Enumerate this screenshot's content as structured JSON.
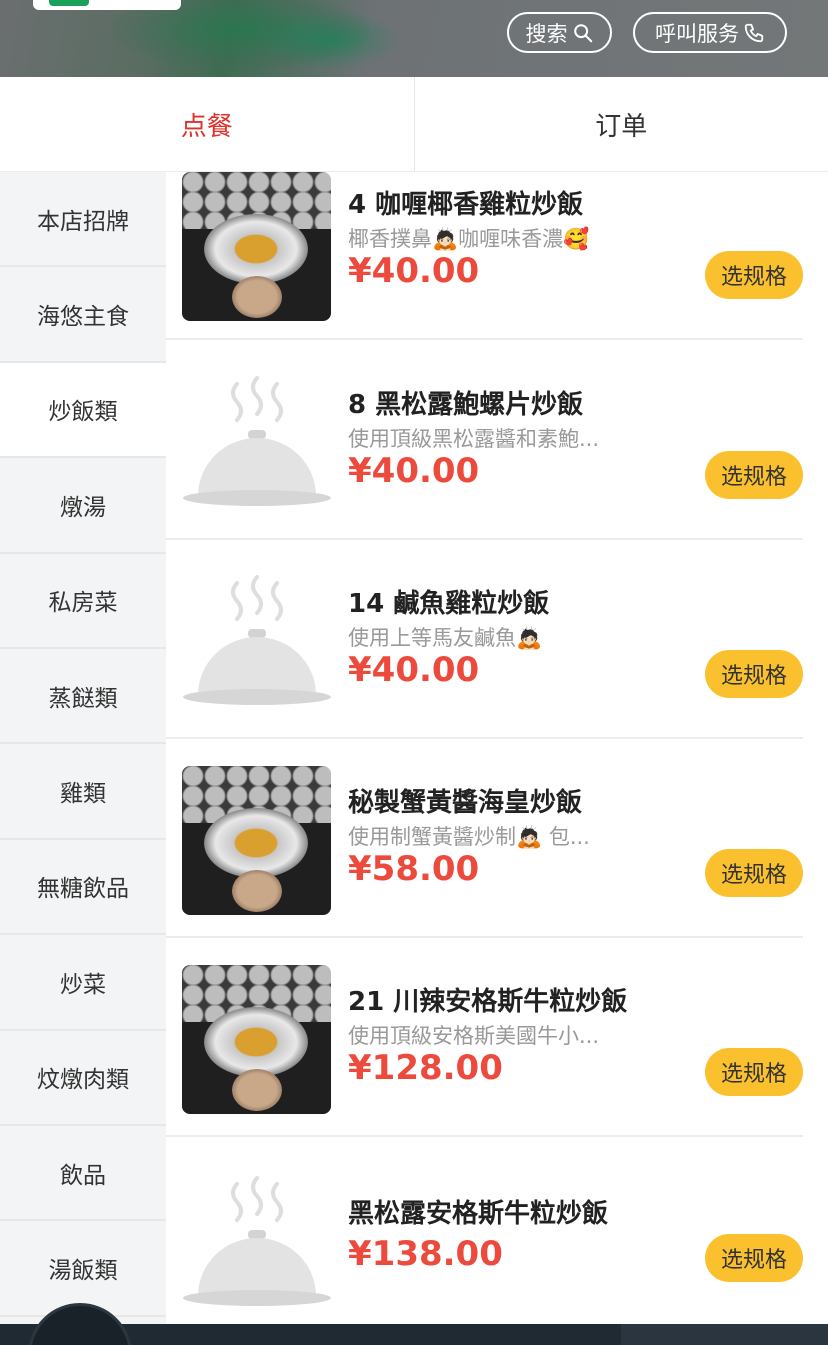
{
  "header": {
    "search_label": "搜索",
    "call_label": "呼叫服务"
  },
  "tabs": [
    {
      "label": "点餐",
      "active": true
    },
    {
      "label": "订单",
      "active": false
    }
  ],
  "sidebar": {
    "items": [
      {
        "label": "本店招牌"
      },
      {
        "label": "海悠主食"
      },
      {
        "label": "炒飯類",
        "active": true
      },
      {
        "label": "燉湯"
      },
      {
        "label": "私房菜"
      },
      {
        "label": "蒸餸類"
      },
      {
        "label": "雞類"
      },
      {
        "label": "無糖飲品"
      },
      {
        "label": "炒菜"
      },
      {
        "label": "炆燉肉類"
      },
      {
        "label": "飲品"
      },
      {
        "label": "湯飯類"
      }
    ]
  },
  "products": [
    {
      "name": "4 咖喱椰香雞粒炒飯",
      "desc": "椰香撲鼻🙇🏻咖喱味香濃🥰",
      "price": "¥40.00",
      "button": "选规格",
      "image": "photo"
    },
    {
      "name": "8 黑松露鮑螺片炒飯",
      "desc": "使用頂級黑松露醬和素鮑...",
      "price": "¥40.00",
      "button": "选规格",
      "image": "placeholder"
    },
    {
      "name": "14 鹹魚雞粒炒飯",
      "desc": "使用上等馬友鹹魚🙇🏻",
      "price": "¥40.00",
      "button": "选规格",
      "image": "placeholder"
    },
    {
      "name": "秘製蟹黃醬海皇炒飯",
      "desc": "使用制蟹黃醬炒制🙇🏻 包...",
      "price": "¥58.00",
      "button": "选规格",
      "image": "photo"
    },
    {
      "name": "21 川辣安格斯牛粒炒飯",
      "desc": "使用頂級安格斯美國牛小...",
      "price": "¥128.00",
      "button": "选规格",
      "image": "photo"
    },
    {
      "name": "黑松露安格斯牛粒炒飯",
      "desc": "",
      "price": "¥138.00",
      "button": "选规格",
      "image": "placeholder"
    }
  ],
  "colors": {
    "accent_red": "#e0322d",
    "price_red": "#ec4a3d",
    "button_yellow": "#fbc02d"
  },
  "icons": {
    "search": "search-icon",
    "call": "phone-icon",
    "placeholder": "food-cloche-icon"
  }
}
